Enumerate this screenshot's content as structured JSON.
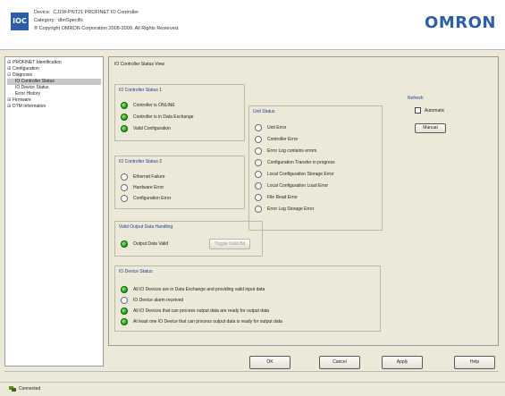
{
  "header": {
    "logo_text": "IOC",
    "device_label": "Device:",
    "device_value": "CJ1W-PNT21 PROFINET IO Controller",
    "category_label": "Category:",
    "category_value": "dtmSpecific",
    "copyright": "® Copyright OMRON Corporation 2008-2009. All Rights Reserved.",
    "brand": "OMRON"
  },
  "tree": {
    "items": [
      {
        "label": "PROFINET Identification",
        "expander": "⊞",
        "level": 0,
        "selected": false
      },
      {
        "label": "Configuration",
        "expander": "⊞",
        "level": 0,
        "selected": false
      },
      {
        "label": "Diagnosis",
        "expander": "⊟",
        "level": 0,
        "selected": false
      },
      {
        "label": "IO Controller Status",
        "expander": "",
        "level": 1,
        "selected": true
      },
      {
        "label": "IO Device Status",
        "expander": "",
        "level": 1,
        "selected": false
      },
      {
        "label": "Error History",
        "expander": "",
        "level": 1,
        "selected": false
      },
      {
        "label": "Firmware",
        "expander": "⊞",
        "level": 0,
        "selected": false
      },
      {
        "label": "DTM Information",
        "expander": "⊞",
        "level": 0,
        "selected": false
      }
    ]
  },
  "main": {
    "title": "IO Controller Status View",
    "status1": {
      "title": "IO Controller Status 1",
      "items": [
        {
          "label": "Controller is ONLINE",
          "state": "on"
        },
        {
          "label": "Controller is in Data Exchange",
          "state": "on"
        },
        {
          "label": "Valid Configuration",
          "state": "on"
        }
      ]
    },
    "status2": {
      "title": "IO Controller Status 2",
      "items": [
        {
          "label": "Ethernet Failure",
          "state": "off"
        },
        {
          "label": "Hardware Error",
          "state": "off"
        },
        {
          "label": "Configuration Error",
          "state": "off"
        }
      ]
    },
    "unit": {
      "title": "Unit Status",
      "items": [
        {
          "label": "Unit Error",
          "state": "off"
        },
        {
          "label": "Controller Error",
          "state": "off"
        },
        {
          "label": "Error Log contains errors",
          "state": "off"
        },
        {
          "label": "Configuration Transfer in progress",
          "state": "off"
        },
        {
          "label": "Local Configuration Storage Error",
          "state": "off"
        },
        {
          "label": "Local Configuration Load Error",
          "state": "off"
        },
        {
          "label": "File Read Error",
          "state": "off"
        },
        {
          "label": "Error Log Storage Error",
          "state": "off"
        }
      ]
    },
    "refresh": {
      "title": "Refresh",
      "automatic_label": "Automatic",
      "manual_label": "Manual"
    },
    "valid_output": {
      "title": "Valid Output Data Handling",
      "item_label": "Output Data Valid",
      "item_state": "on",
      "button_label": "Toggle Valid Bit"
    },
    "device": {
      "title": "IO Device Status",
      "items": [
        {
          "label": "All IO Devices are in Data Exchange and providing valid input data",
          "state": "on"
        },
        {
          "label": "IO Device alarm received",
          "state": "off"
        },
        {
          "label": "All IO Devices that can process output data are ready for output data",
          "state": "on"
        },
        {
          "label": "At least one IO Device that can process output data is ready for output data",
          "state": "on"
        }
      ]
    }
  },
  "buttons": {
    "ok": "OK",
    "cancel": "Cancel",
    "apply": "Apply",
    "help": "Help"
  },
  "status_bar": {
    "text": "Connected"
  }
}
